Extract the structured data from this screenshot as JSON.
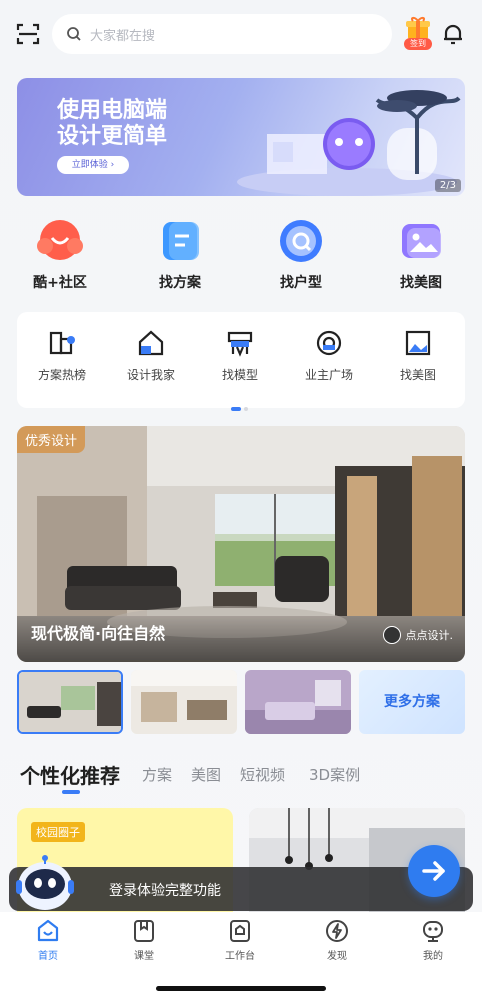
{
  "search": {
    "placeholder": "大家都在搜"
  },
  "gift_badge": "签到",
  "banner": {
    "line1": "使用电脑端",
    "line2": "设计更简单",
    "button": "立即体验 ›",
    "page": "2/3"
  },
  "categories": [
    {
      "label": "酷+社区",
      "icon": "community-icon"
    },
    {
      "label": "找方案",
      "icon": "plan-icon"
    },
    {
      "label": "找户型",
      "icon": "floorplan-icon"
    },
    {
      "label": "找美图",
      "icon": "gallery-icon"
    }
  ],
  "subnav": [
    {
      "label": "方案热榜",
      "icon": "ranking-icon"
    },
    {
      "label": "设计我家",
      "icon": "home-icon"
    },
    {
      "label": "找模型",
      "icon": "model-icon"
    },
    {
      "label": "业主广场",
      "icon": "square-icon"
    },
    {
      "label": "找美图",
      "icon": "picture-icon"
    }
  ],
  "featured": {
    "tag": "优秀设计",
    "title": "现代极简·向往自然",
    "author": "点点设计."
  },
  "more_plans": "更多方案",
  "tabs": [
    {
      "label": "个性化推荐",
      "active": true
    },
    {
      "label": "方案"
    },
    {
      "label": "美图"
    },
    {
      "label": "短视频"
    },
    {
      "label": "3D案例"
    }
  ],
  "feed": {
    "card1_tag": "校园圈子"
  },
  "login_prompt": "登录体验完整功能",
  "bottom_nav": [
    {
      "label": "首页",
      "icon": "home-tab-icon",
      "active": true
    },
    {
      "label": "课堂",
      "icon": "classroom-icon"
    },
    {
      "label": "工作台",
      "icon": "workbench-icon"
    },
    {
      "label": "发现",
      "icon": "discover-icon"
    },
    {
      "label": "我的",
      "icon": "profile-icon"
    }
  ],
  "colors": {
    "accent": "#2f7cf0",
    "tag_orange": "#d39a59"
  }
}
